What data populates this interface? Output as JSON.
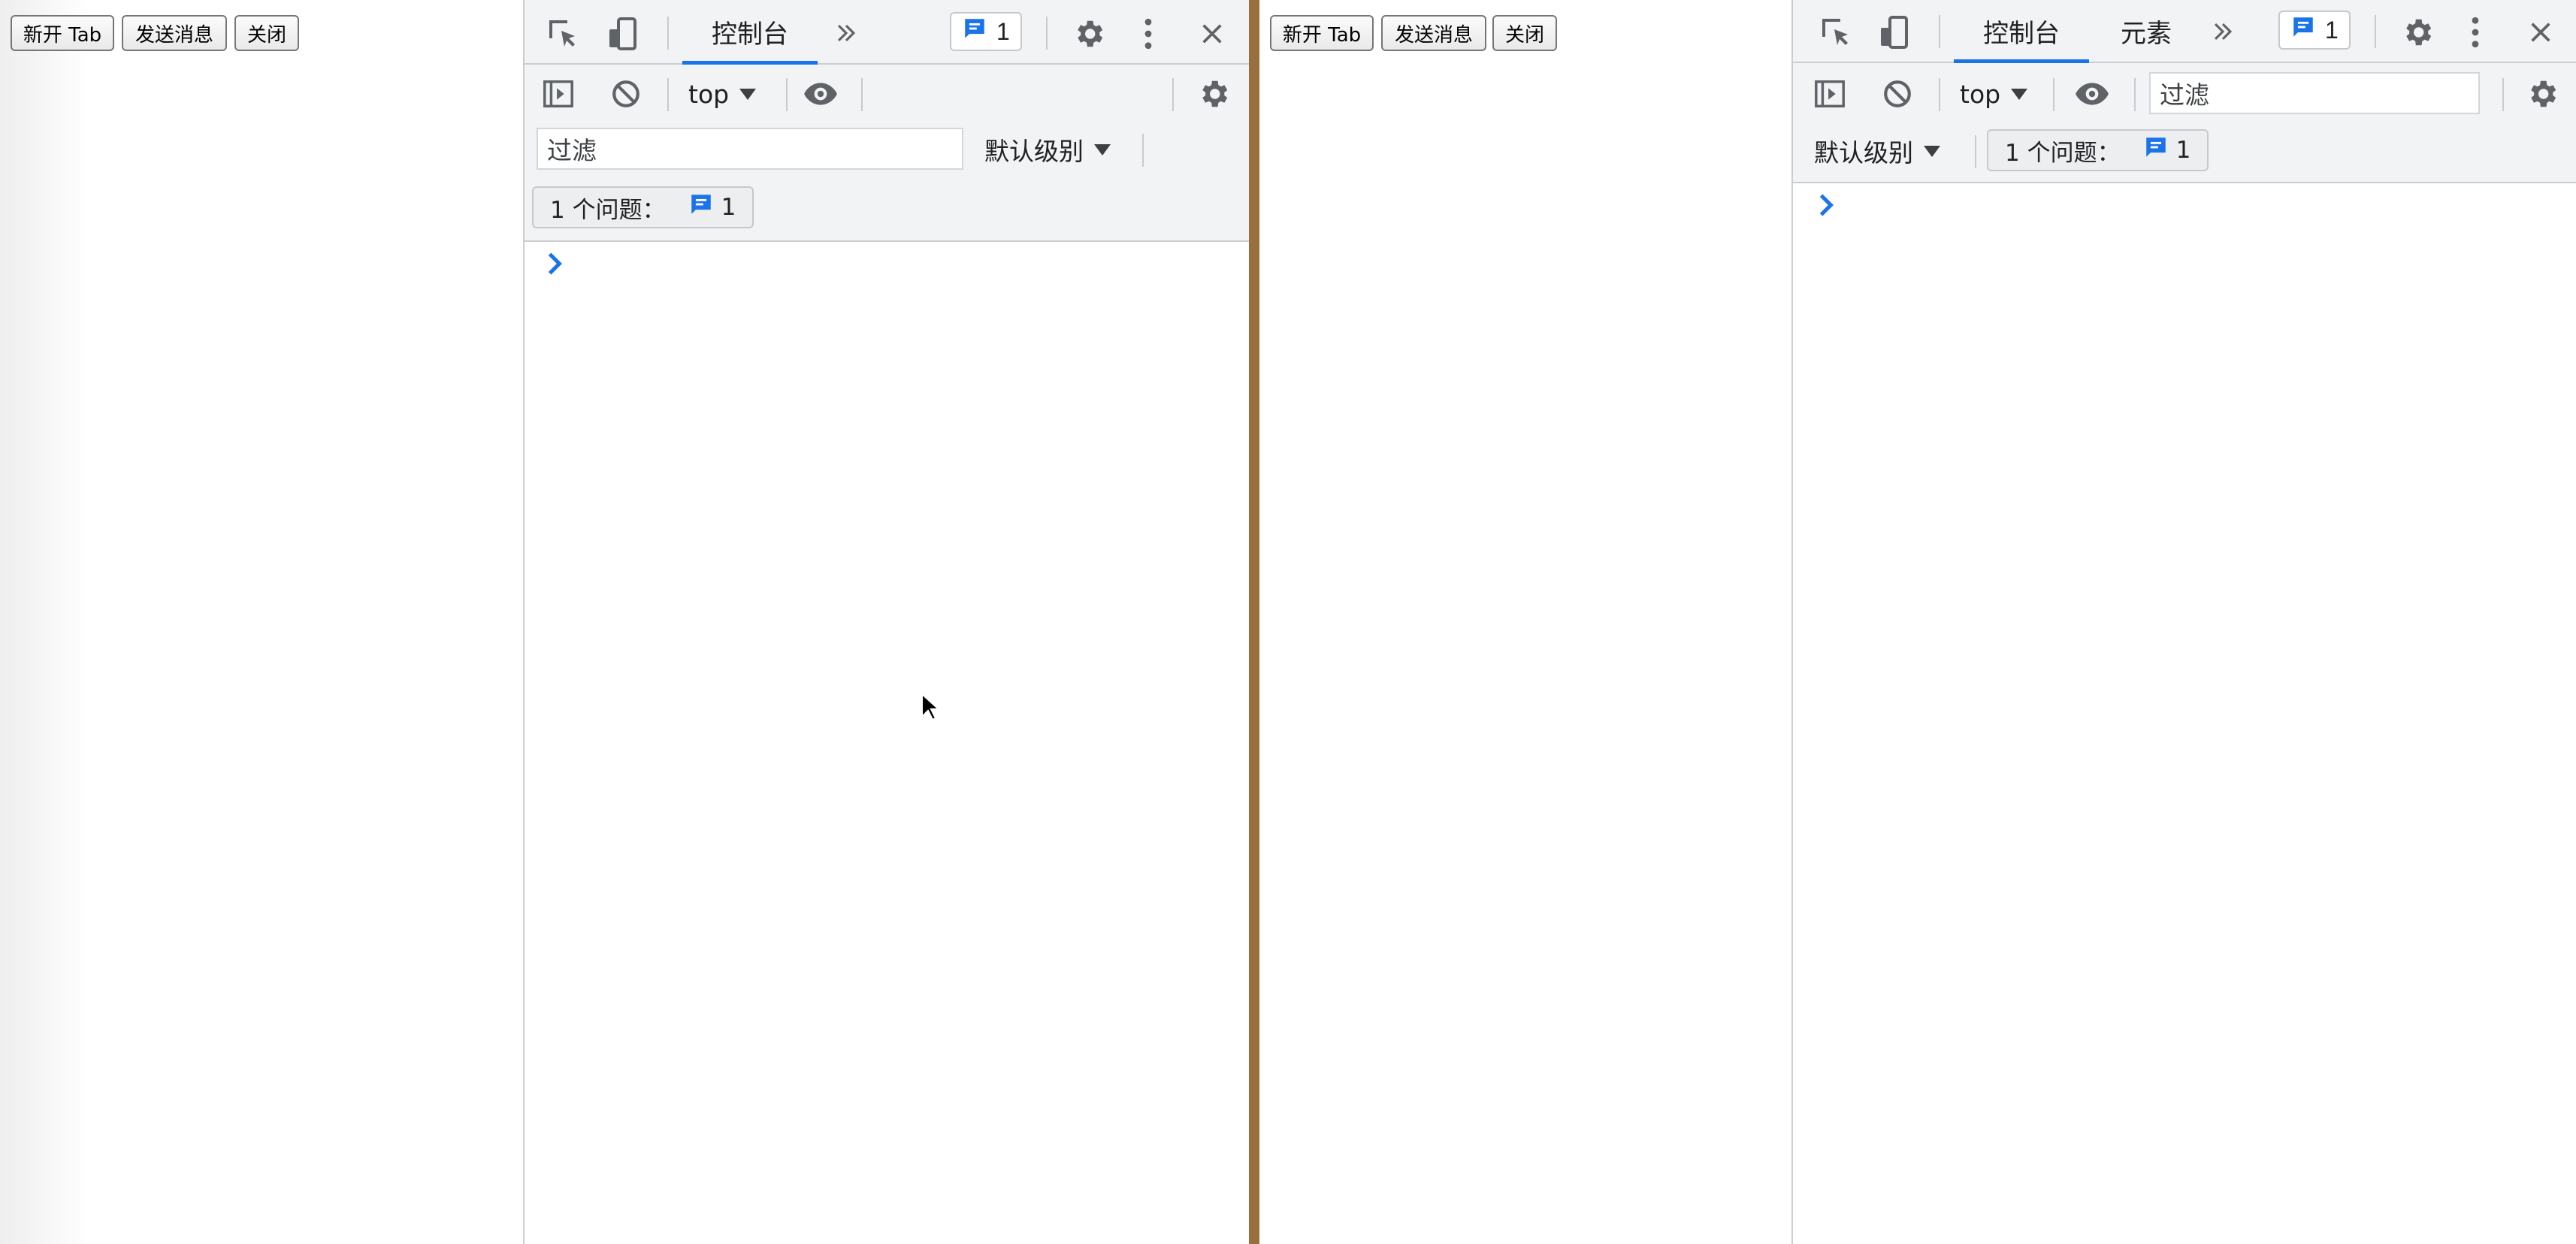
{
  "page_buttons": {
    "new_tab": "新开 Tab",
    "send_message": "发送消息",
    "close": "关闭"
  },
  "devtools": {
    "console_tab": "控制台",
    "elements_tab": "元素",
    "issue_badge_count": "1",
    "context_selector": "top",
    "filter_placeholder": "过滤",
    "log_level": "默认级别",
    "issues_label": "1 个问题：",
    "issues_count": "1",
    "prompt_symbol": "›"
  },
  "colors": {
    "accent": "#1a73e8",
    "toolbar_bg": "#f1f3f4",
    "separator": "#9a6f3e"
  },
  "icons": [
    "inspect-element-icon",
    "device-toolbar-icon",
    "more-tabs-icon",
    "issues-message-icon",
    "settings-gear-icon",
    "kebab-menu-icon",
    "close-icon",
    "sidebar-toggle-icon",
    "clear-console-icon",
    "eye-icon",
    "chevron-prompt-icon",
    "mouse-cursor-icon"
  ]
}
